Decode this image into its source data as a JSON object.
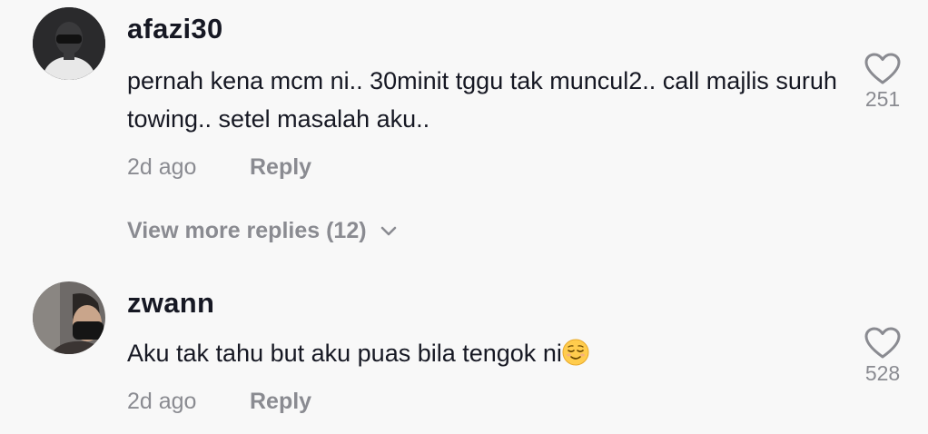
{
  "comments": [
    {
      "username": "afazi30",
      "text": "pernah kena mcm ni.. 30minit tggu tak muncul2.. call majlis suruh towing.. setel masalah aku..",
      "timestamp": "2d ago",
      "reply_label": "Reply",
      "likes": "251"
    },
    {
      "username": "zwann",
      "text": "Aku tak tahu but aku puas bila tengok ni",
      "emoji": "relieved-face-emoji",
      "timestamp": "2d ago",
      "reply_label": "Reply",
      "likes": "528"
    }
  ],
  "view_more": {
    "label": "View more replies (12)"
  },
  "icons": {
    "like": "heart-outline-icon",
    "expand": "chevron-down-icon"
  },
  "colors": {
    "background": "#f8f8f8",
    "primary_text": "#161823",
    "secondary_text": "#8a8b91"
  }
}
